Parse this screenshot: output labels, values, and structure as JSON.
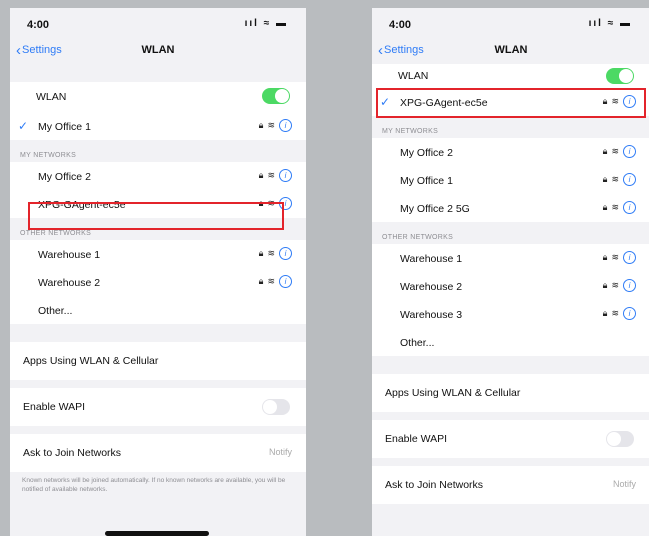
{
  "left": {
    "time": "4:00",
    "status_icons": "ııl ≈ ▬",
    "back_label": "Settings",
    "title": "WLAN",
    "wlan_label": "WLAN",
    "connected": "My Office 1",
    "my_networks_header": "MY NETWORKS",
    "my_networks": [
      "My Office 2",
      "XPG-GAgent-ec5e"
    ],
    "other_networks_header": "OTHER NETWORKS",
    "other_networks": [
      "Warehouse 1",
      "Warehouse 2"
    ],
    "other_label": "Other...",
    "apps_label": "Apps Using WLAN & Cellular",
    "wapi_label": "Enable WAPI",
    "ask_label": "Ask to Join Networks",
    "ask_value": "Notify",
    "footnote": "Known networks will be joined automatically. If no known networks are available, you will be notified of available networks."
  },
  "right": {
    "time": "4:00",
    "status_icons": "ııl ≈ ▬",
    "back_label": "Settings",
    "title": "WLAN",
    "wlan_label": "WLAN",
    "connected": "XPG-GAgent-ec5e",
    "my_networks_header": "MY NETWORKS",
    "my_networks": [
      "My Office 2",
      "My Office 1",
      "My Office 2 5G"
    ],
    "other_networks_header": "OTHER NETWORKS",
    "other_networks": [
      "Warehouse 1",
      "Warehouse 2",
      "Warehouse 3"
    ],
    "other_label": "Other...",
    "apps_label": "Apps Using WLAN & Cellular",
    "wapi_label": "Enable WAPI",
    "ask_label": "Ask to Join Networks",
    "ask_value": "Notify"
  },
  "icons": {
    "lock": "lock-icon",
    "wifi": "wifi-icon",
    "info": "info-icon",
    "check": "checkmark-icon",
    "back": "chevron-left-icon"
  },
  "colors": {
    "accent": "#2f7cf6",
    "toggle_on": "#4cd964",
    "highlight": "#e3242b"
  }
}
